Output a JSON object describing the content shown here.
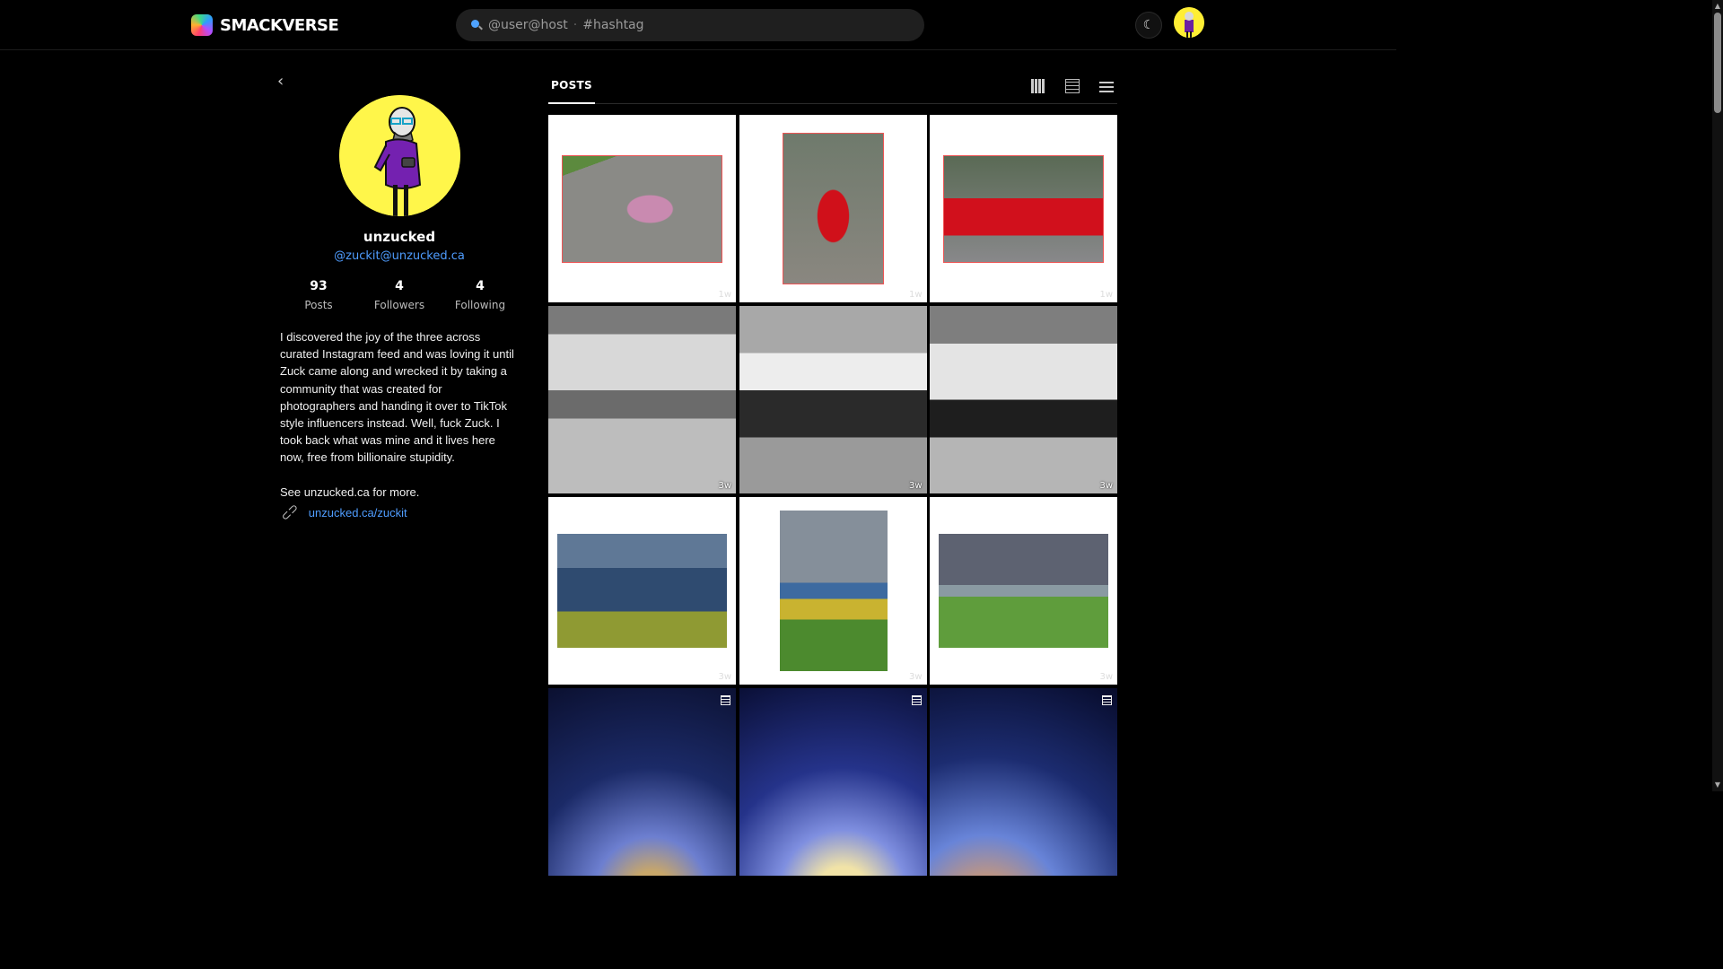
{
  "brand": {
    "name": "SMACKVERSE"
  },
  "search": {
    "placeholder_user": "@user@host",
    "separator": "·",
    "placeholder_tag": "#hashtag"
  },
  "header": {
    "theme_icon": "moon-icon"
  },
  "profile": {
    "back_icon": "‹",
    "display_name": "unzucked",
    "handle": "@zuckit@unzucked.ca",
    "stats": [
      {
        "value": "93",
        "label": "Posts"
      },
      {
        "value": "4",
        "label": "Followers"
      },
      {
        "value": "4",
        "label": "Following"
      }
    ],
    "bio_paragraph_1": "I discovered the joy of the three across curated Instagram feed and was loving it until Zuck came along and wrecked it by taking a community that was created for photographers and handing it over to TikTok style influencers instead. Well, fuck Zuck. I took back what was mine and it lives here now, free from billionaire stupidity.",
    "bio_paragraph_2": "See unzucked.ca for more.",
    "link": "unzucked.ca/zuckit"
  },
  "tabs": {
    "posts_label": "POSTS"
  },
  "posts": [
    {
      "photo": "chalk",
      "time": "1w"
    },
    {
      "photo": "girl",
      "time": "1w"
    },
    {
      "photo": "wagon",
      "time": "1w"
    },
    {
      "photo": "ir1",
      "time": "3w"
    },
    {
      "photo": "ir2",
      "time": "3w"
    },
    {
      "photo": "ir3",
      "time": "3w"
    },
    {
      "photo": "storm",
      "time": "3w"
    },
    {
      "photo": "fence",
      "time": "3w"
    },
    {
      "photo": "bench",
      "time": "3w"
    },
    {
      "photo": "fire1",
      "time": ""
    },
    {
      "photo": "fire2",
      "time": ""
    },
    {
      "photo": "fire3",
      "time": ""
    }
  ]
}
